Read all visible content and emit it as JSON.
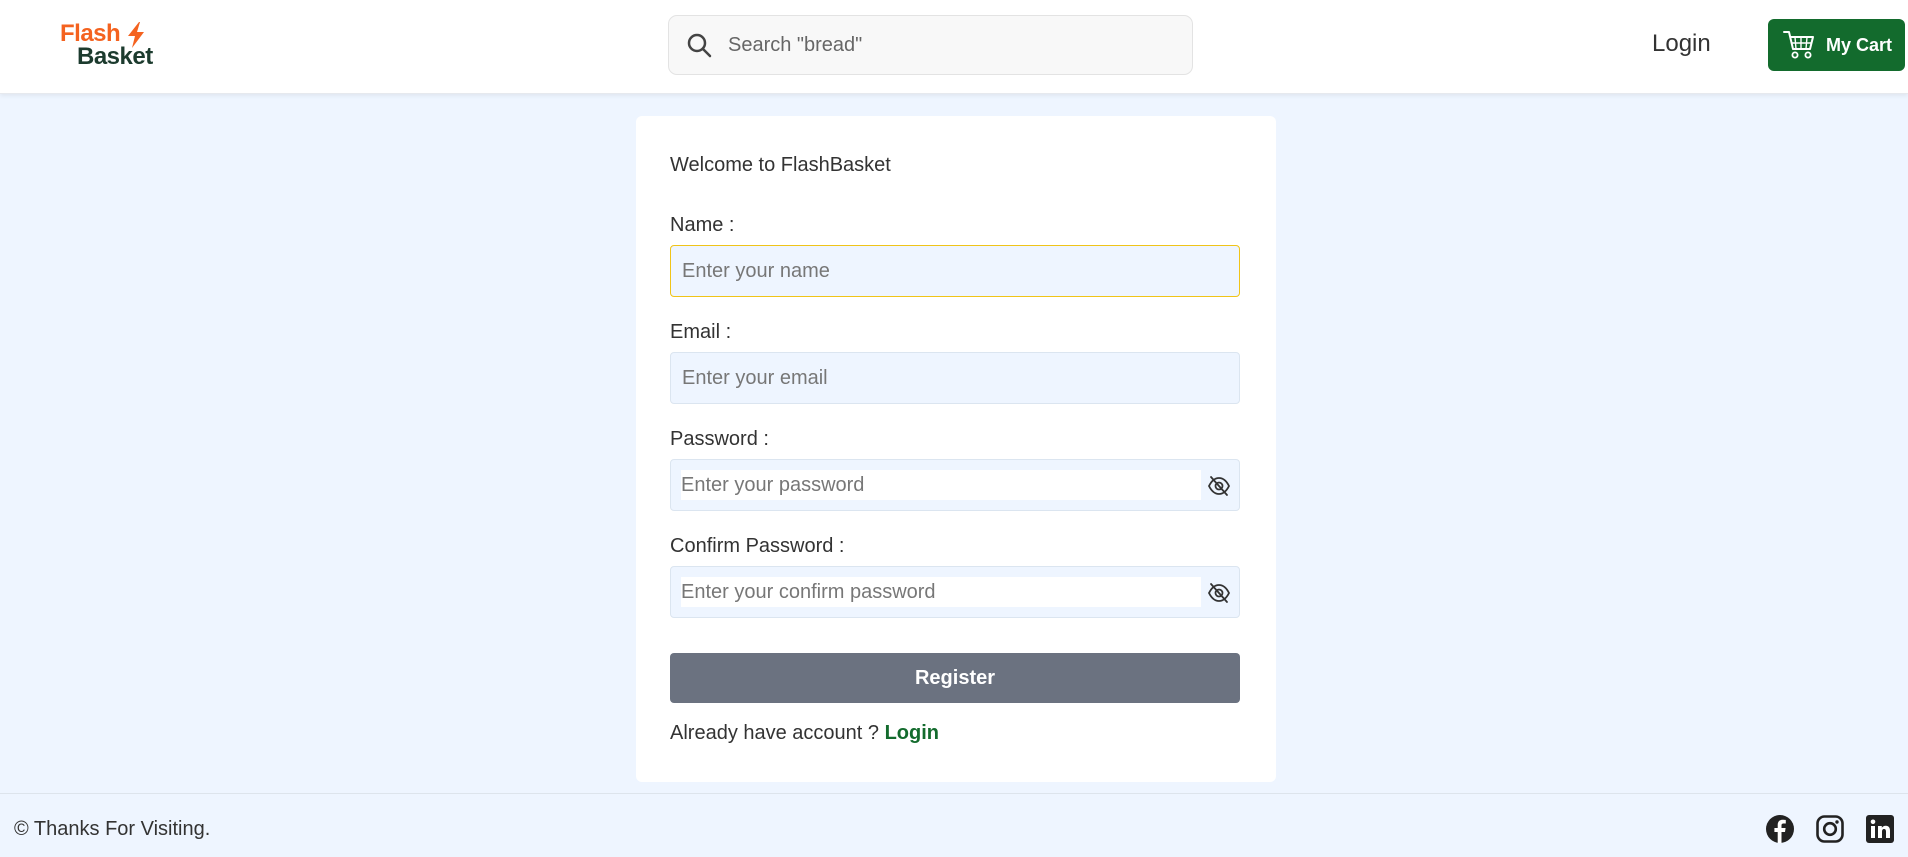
{
  "header": {
    "logo": {
      "line1": "Flash",
      "line2": "Basket"
    },
    "search": {
      "placeholder": "Search \"bread\"",
      "icon": "search-icon"
    },
    "login_label": "Login",
    "cart": {
      "label": "My Cart",
      "icon": "shopping-cart-icon"
    }
  },
  "form": {
    "welcome": "Welcome to FlashBasket",
    "fields": [
      {
        "label": "Name :",
        "placeholder": "Enter your name"
      },
      {
        "label": "Email :",
        "placeholder": "Enter your email"
      },
      {
        "label": "Password :",
        "placeholder": "Enter your password",
        "icon": "eye-slash-icon"
      },
      {
        "label": "Confirm Password :",
        "placeholder": "Enter your confirm password",
        "icon": "eye-slash-icon"
      }
    ],
    "register_label": "Register",
    "have_account_text": "Already have account ?",
    "login_link": "Login"
  },
  "footer": {
    "copyright": "© Thanks For Visiting.",
    "social": [
      "facebook-icon",
      "instagram-icon",
      "linkedin-icon"
    ]
  },
  "colors": {
    "brand_orange": "#f4621f",
    "brand_dark": "#1c3b2e",
    "accent_green": "#136b2d",
    "button_gray": "#6b7280",
    "page_bg": "#eef5ff",
    "focus_border": "#f0c419"
  }
}
